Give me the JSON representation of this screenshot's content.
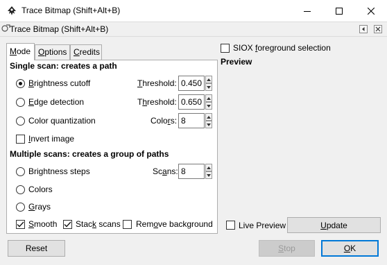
{
  "window": {
    "title": "Trace Bitmap (Shift+Alt+B)",
    "app_icon": "inkscape-logo-icon",
    "minimize_icon": "minimize-icon",
    "maximize_icon": "maximize-icon",
    "close_icon": "close-icon"
  },
  "dock": {
    "title": "Trace Bitmap (Shift+Alt+B)",
    "icon": "trace-bitmap-icon",
    "collapse_icon": "collapse-left-icon",
    "close_icon": "close-icon"
  },
  "tabs": {
    "mode": {
      "pre": "",
      "accel": "M",
      "post": "ode"
    },
    "options": {
      "pre": "",
      "accel": "O",
      "post": "ptions"
    },
    "credits": {
      "pre": "",
      "accel": "C",
      "post": "redits"
    }
  },
  "single_scan": {
    "heading": "Single scan: creates a path",
    "brightness": {
      "pre": "",
      "accel": "B",
      "post": "rightness cutoff",
      "checked": true
    },
    "brightness_threshold": {
      "label_pre": "",
      "label_accel": "T",
      "label_post": "hreshold:",
      "value": "0.450"
    },
    "edge": {
      "pre": "",
      "accel": "E",
      "post": "dge detection",
      "checked": false
    },
    "edge_threshold": {
      "label_pre": "T",
      "label_accel": "h",
      "label_post": "reshold:",
      "value": "0.650"
    },
    "color_quant": {
      "pre": "Color quantization",
      "checked": false
    },
    "colors": {
      "label_pre": "Colo",
      "label_accel": "r",
      "label_post": "s:",
      "value": "8"
    },
    "invert": {
      "pre": "",
      "accel": "I",
      "post": "nvert image",
      "checked": false
    }
  },
  "multiple_scans": {
    "heading": "Multiple scans: creates a group of paths",
    "brightness_steps": {
      "pre": "Brightness steps",
      "checked": false
    },
    "scans": {
      "label_pre": "Sc",
      "label_accel": "a",
      "label_post": "ns:",
      "value": "8"
    },
    "colors": {
      "pre": "Colors",
      "checked": false
    },
    "grays": {
      "pre": "",
      "accel": "G",
      "post": "rays",
      "checked": false
    },
    "smooth": {
      "pre": "",
      "accel": "S",
      "post": "mooth",
      "checked": true
    },
    "stack": {
      "pre": "Stac",
      "accel": "k",
      "post": " scans",
      "checked": true
    },
    "remove_bg": {
      "pre": "Rem",
      "accel": "o",
      "post": "ve background",
      "checked": false
    }
  },
  "right": {
    "siox": {
      "pre": "SIOX ",
      "accel": "f",
      "post": "oreground selection",
      "checked": false
    },
    "preview_heading": "Preview",
    "live_preview": {
      "label": "Live Preview",
      "checked": false
    },
    "update": {
      "pre": "",
      "accel": "U",
      "post": "pdate"
    }
  },
  "footer": {
    "reset": "Reset",
    "stop": {
      "pre": "",
      "accel": "S",
      "post": "top"
    },
    "ok": {
      "pre": "",
      "accel": "O",
      "post": "K"
    }
  }
}
